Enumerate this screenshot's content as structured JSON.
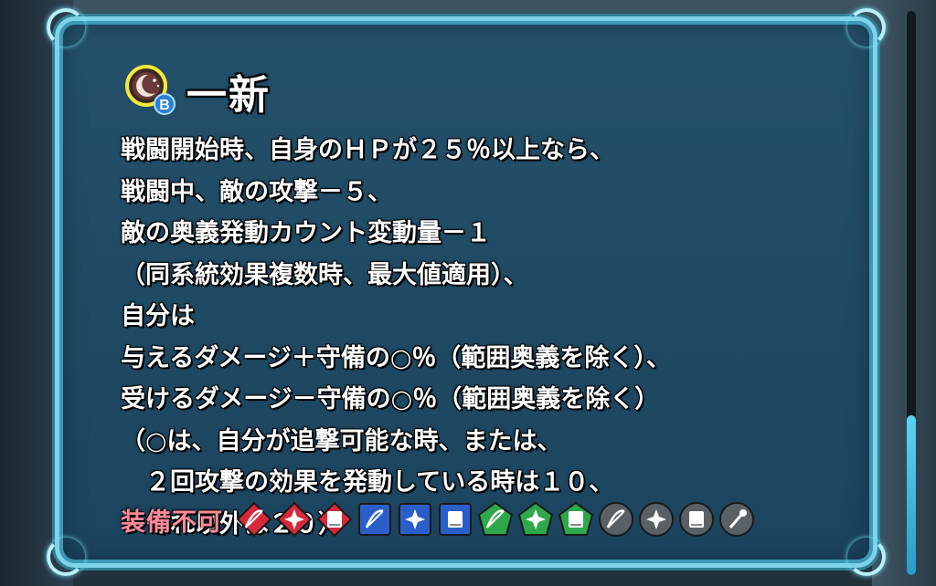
{
  "skill": {
    "title": "一新",
    "slot_letter": "B",
    "icon": "skill-crescent-icon"
  },
  "description": [
    "戦闘開始時、自身のＨＰが２５％以上なら、",
    "戦闘中、敵の攻撃－５、",
    "敵の奥義発動カウント変動量－１",
    "（同系統効果複数時、最大値適用）、",
    "自分は",
    "与えるダメージ＋守備の○％（範囲奥義を除く）、",
    "受けるダメージ－守備の○％（範囲奥義を除く）",
    "（○は、自分が追撃可能な時、または、",
    "　２回攻撃の効果を発動している時は１０、",
    "　それ以外は２０）"
  ],
  "equip": {
    "label": "装備不可",
    "weapons": [
      {
        "name": "red-bow-icon",
        "color": "#d8283c",
        "shape": "diamond",
        "glyph": "bow"
      },
      {
        "name": "red-dagger-icon",
        "color": "#d8283c",
        "shape": "diamond",
        "glyph": "dagger"
      },
      {
        "name": "red-tome-icon",
        "color": "#d8283c",
        "shape": "diamond",
        "glyph": "tome"
      },
      {
        "name": "blue-bow-icon",
        "color": "#2a5fc9",
        "shape": "square",
        "glyph": "bow"
      },
      {
        "name": "blue-dagger-icon",
        "color": "#2a5fc9",
        "shape": "square",
        "glyph": "dagger"
      },
      {
        "name": "blue-tome-icon",
        "color": "#2a5fc9",
        "shape": "square",
        "glyph": "tome"
      },
      {
        "name": "green-bow-icon",
        "color": "#2da84a",
        "shape": "pentagon",
        "glyph": "bow"
      },
      {
        "name": "green-dagger-icon",
        "color": "#2da84a",
        "shape": "pentagon",
        "glyph": "dagger"
      },
      {
        "name": "green-tome-icon",
        "color": "#2da84a",
        "shape": "pentagon",
        "glyph": "tome"
      },
      {
        "name": "gray-bow-icon",
        "color": "#5a6166",
        "shape": "circle",
        "glyph": "bow"
      },
      {
        "name": "gray-dagger-icon",
        "color": "#5a6166",
        "shape": "circle",
        "glyph": "dagger"
      },
      {
        "name": "gray-tome-icon",
        "color": "#5a6166",
        "shape": "circle",
        "glyph": "tome"
      },
      {
        "name": "gray-staff-icon",
        "color": "#5a6166",
        "shape": "circle",
        "glyph": "staff"
      }
    ]
  },
  "colors": {
    "panel_border": "#7fd3e8",
    "text": "#ffffff",
    "equip_label": "#ff8a9a"
  }
}
